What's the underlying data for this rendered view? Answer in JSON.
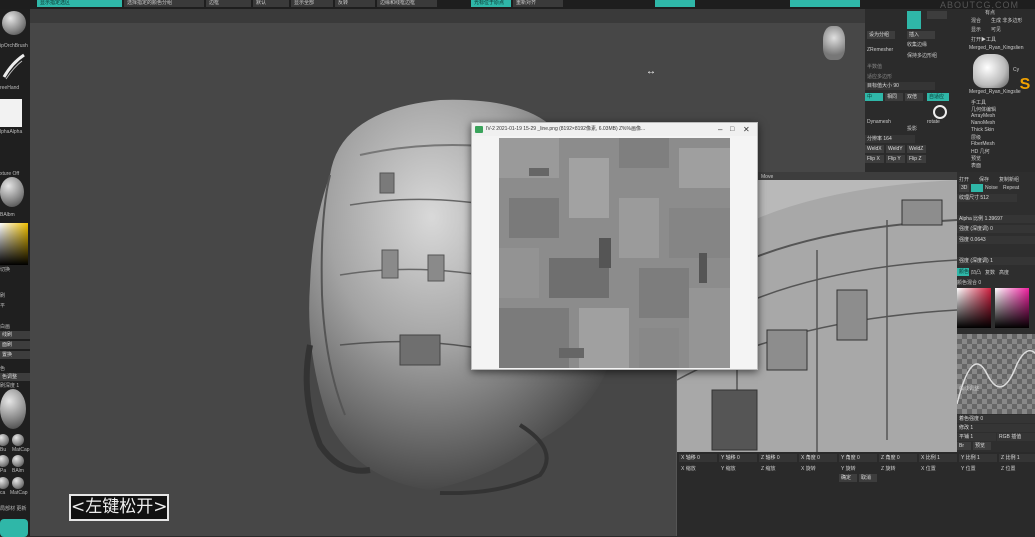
{
  "top_menu": {
    "items": [
      "显示指定选区",
      "选择指定的颜色分组",
      "边框",
      "默认",
      "显示全部",
      "反转",
      "光标位于原点",
      "重新对齐",
      "边缘和线框边框"
    ]
  },
  "left_shelf": {
    "brush_name": "ipOrchBrush",
    "stroke_name": "reeHand",
    "alpha_name": "lphaAlpha",
    "texture_label": "xture Off",
    "material_label": "BAlbm",
    "color_label": "切换",
    "items": [
      "刷",
      "平",
      "白画",
      "线刷",
      "面刷",
      "置换",
      "色",
      "色调整",
      "笔刷"
    ],
    "depth_label": "刷深度 1",
    "mat_labels": [
      "Bu",
      "MatCap",
      "Pa",
      "BAlm",
      "ca",
      "MatCap"
    ],
    "bottom_label": "局部材 更新"
  },
  "subtitle": {
    "text": "<左键松开>"
  },
  "image_viewer": {
    "title": "IV-2 2021-01-19 15-29 _line.png  (8192×8192像素, 6.03MB)  Z%%画像...",
    "buttons": [
      "minimize-icon",
      "maximize-icon",
      "close-icon"
    ]
  },
  "right_panel": {
    "header_labels": [
      "有点",
      "生成 非多边形",
      "混合",
      "显示",
      "可见"
    ],
    "sections": {
      "row1": [
        "设为分组",
        "插入"
      ],
      "zremesher": "ZRemesher",
      "row2": [
        "收集边缘",
        "保持多边形组"
      ],
      "row3": "半数值",
      "adaptive": "适应多边形",
      "target": "目标值大小 90",
      "row4": [
        "中",
        "相同",
        "双倍",
        "自适应"
      ],
      "dynamesh": "Dynamesh",
      "resolution": "分辨率 164",
      "weld": [
        "WeldX",
        "WeldY",
        "WeldZ"
      ],
      "flip": [
        "Flip X",
        "Flip Y",
        "Flip Z"
      ],
      "project": "投影",
      "rotate_label": "rotate"
    },
    "tool_menu": {
      "tool_name": "Merged_Ryan_Kingslien",
      "tool_name_2": "Merged_Ryan_Kingslie",
      "items": [
        "手工具",
        "几何体编辑",
        "ArrayMesh",
        "NanoMesh",
        "Thick Skin",
        "层级",
        "FiberMesh",
        "HD 几何",
        "预览",
        "表面"
      ],
      "letter_s": "S"
    },
    "col_label": "打开▶工具",
    "cy": "Cy"
  },
  "secondary_zbrush": {
    "title": "Move",
    "panel": {
      "header": [
        "打开",
        "保存",
        "复制新组"
      ],
      "tabs": [
        "3D",
        "Intensity",
        "Noise",
        "Repeat"
      ],
      "tile": "纹理尺寸 512",
      "alpha": "Alpha 比例 1.39697",
      "strength_1": "强度 (深度调) 0",
      "strength_2": "强度 0.0643",
      "strength_3": "强度 (深度调) 1",
      "rgb_label": "RGB",
      "bottom_labels": [
        "颜色",
        "凹凸",
        "复数",
        "高度",
        "法线",
        "高度"
      ],
      "curve_label": "曲线调整",
      "color_label": "颜色混合 0",
      "chan_rows": [
        "着色强度 0",
        "修改 1",
        "平铺 1",
        "RGB 插值",
        "Br",
        "预览"
      ]
    },
    "bottom_bar": {
      "values": [
        "X 轴移 0",
        "Y 轴移 0",
        "Z 轴移 0",
        "X 角度 0",
        "Y 角度 0",
        "Z 角度 0",
        "X 比例 1",
        "Y 比例 1",
        "Z 比例 1"
      ],
      "row2": [
        "X 缩放",
        "Y 缩放",
        "Z 缩放",
        "X 旋转",
        "Y 旋转",
        "Z 旋转",
        "X 位置",
        "Y 位置",
        "Z 位置"
      ],
      "buttons": [
        "确定",
        "取消"
      ]
    }
  },
  "watermark": "ABOUTCG.COM",
  "colors": {
    "accent": "#2fb7a8"
  }
}
